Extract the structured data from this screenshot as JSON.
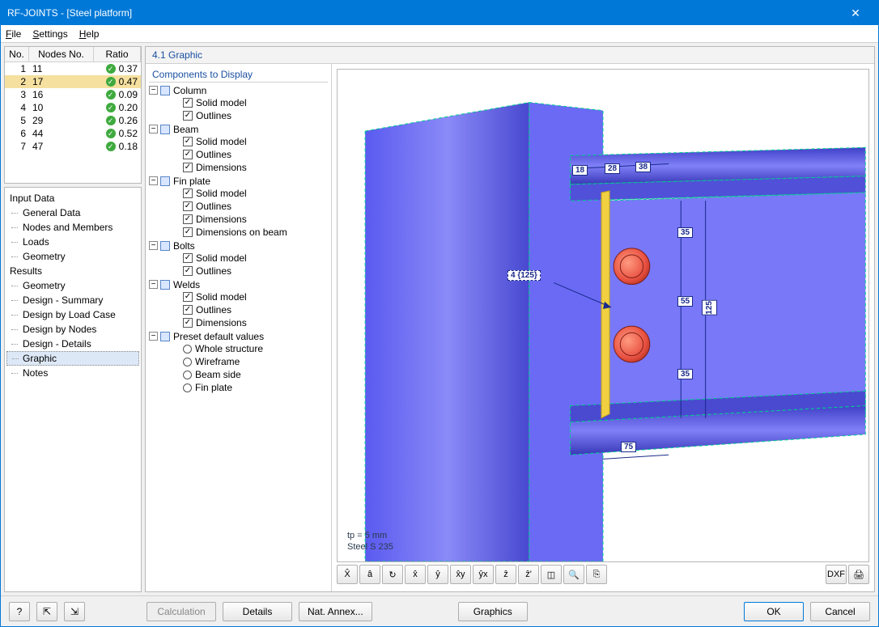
{
  "window": {
    "title": "RF-JOINTS - [Steel platform]"
  },
  "menu": {
    "file": "File",
    "settings": "Settings",
    "help": "Help"
  },
  "table": {
    "headers": {
      "no": "No.",
      "nodes": "Nodes No.",
      "ratio": "Ratio"
    },
    "rows": [
      {
        "no": "1",
        "nodes": "11",
        "ratio": "0.37"
      },
      {
        "no": "2",
        "nodes": "17",
        "ratio": "0.47"
      },
      {
        "no": "3",
        "nodes": "16",
        "ratio": "0.09"
      },
      {
        "no": "4",
        "nodes": "10",
        "ratio": "0.20"
      },
      {
        "no": "5",
        "nodes": "29",
        "ratio": "0.26"
      },
      {
        "no": "6",
        "nodes": "44",
        "ratio": "0.52"
      },
      {
        "no": "7",
        "nodes": "47",
        "ratio": "0.18"
      }
    ],
    "selected_index": 1
  },
  "nav": {
    "group1": "Input Data",
    "items1": [
      "General Data",
      "Nodes and Members",
      "Loads",
      "Geometry"
    ],
    "group2": "Results",
    "items2": [
      "Geometry",
      "Design - Summary",
      "Design by Load Case",
      "Design by Nodes",
      "Design - Details",
      "Graphic",
      "Notes"
    ],
    "selected_item2_index": 5
  },
  "panel": {
    "title": "4.1 Graphic"
  },
  "tree": {
    "title": "Components to Display",
    "nodes": [
      {
        "label": "Column",
        "state": "partial",
        "children": [
          {
            "label": "Solid model",
            "state": "checked"
          },
          {
            "label": "Outlines",
            "state": "checked"
          }
        ]
      },
      {
        "label": "Beam",
        "state": "partial",
        "children": [
          {
            "label": "Solid model",
            "state": "checked"
          },
          {
            "label": "Outlines",
            "state": "checked"
          },
          {
            "label": "Dimensions",
            "state": "checked"
          }
        ]
      },
      {
        "label": "Fin plate",
        "state": "partial",
        "children": [
          {
            "label": "Solid model",
            "state": "checked"
          },
          {
            "label": "Outlines",
            "state": "checked"
          },
          {
            "label": "Dimensions",
            "state": "checked"
          },
          {
            "label": "Dimensions on beam",
            "state": "checked"
          }
        ]
      },
      {
        "label": "Bolts",
        "state": "partial",
        "children": [
          {
            "label": "Solid model",
            "state": "checked"
          },
          {
            "label": "Outlines",
            "state": "checked"
          }
        ]
      },
      {
        "label": "Welds",
        "state": "partial",
        "children": [
          {
            "label": "Solid model",
            "state": "checked"
          },
          {
            "label": "Outlines",
            "state": "checked"
          },
          {
            "label": "Dimensions",
            "state": "checked"
          }
        ]
      },
      {
        "label": "Preset default values",
        "state": "partial",
        "children": [
          {
            "label": "Whole structure",
            "kind": "radio"
          },
          {
            "label": "Wireframe",
            "kind": "radio"
          },
          {
            "label": "Beam side",
            "kind": "radio"
          },
          {
            "label": "Fin plate",
            "kind": "radio"
          }
        ]
      }
    ]
  },
  "graphic": {
    "dims": {
      "d18": "18",
      "d28": "28",
      "d38": "38",
      "d35a": "35",
      "d55": "55",
      "d35b": "35",
      "d125": "125",
      "d75": "75"
    },
    "callout": "4 {125}",
    "annot1": "tp = 5 mm",
    "annot2": "Steel S 235"
  },
  "toolbar": {
    "btns": [
      "X̂",
      "â",
      "↻",
      "x̂",
      "ŷ",
      "x̂y",
      "ŷx",
      "ẑ",
      "ẑ'",
      "◫",
      "🔍",
      "⎘"
    ],
    "right": [
      "DXF",
      "🖨"
    ]
  },
  "bottom": {
    "calc": "Calculation",
    "details": "Details",
    "nat": "Nat. Annex...",
    "graphics": "Graphics",
    "ok": "OK",
    "cancel": "Cancel"
  }
}
